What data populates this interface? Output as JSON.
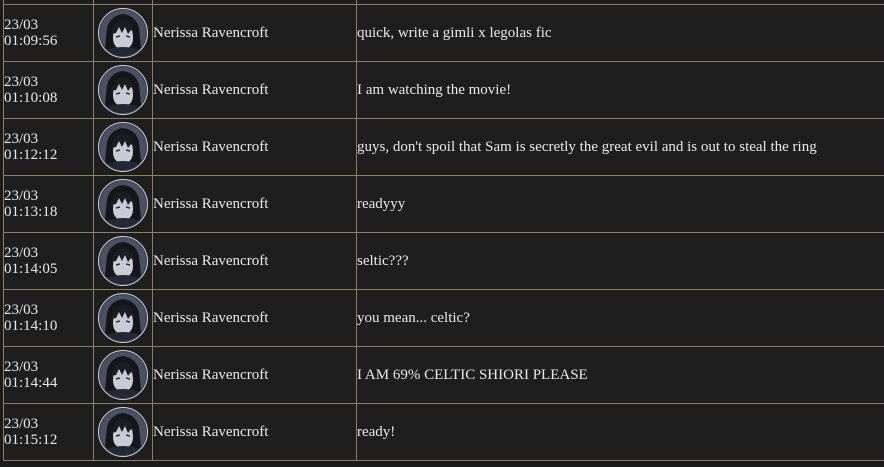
{
  "messages": [
    {
      "date": "23/03",
      "time": "01:09:56",
      "user": "Nerissa Ravencroft",
      "text": "quick, write a gimli x legolas fic"
    },
    {
      "date": "23/03",
      "time": "01:10:08",
      "user": "Nerissa Ravencroft",
      "text": "I am watching the movie!"
    },
    {
      "date": "23/03",
      "time": "01:12:12",
      "user": "Nerissa Ravencroft",
      "text": "guys, don't spoil that Sam is secretly the great evil and is out to steal the ring"
    },
    {
      "date": "23/03",
      "time": "01:13:18",
      "user": "Nerissa Ravencroft",
      "text": "readyyy"
    },
    {
      "date": "23/03",
      "time": "01:14:05",
      "user": "Nerissa Ravencroft",
      "text": "seltic???"
    },
    {
      "date": "23/03",
      "time": "01:14:10",
      "user": "Nerissa Ravencroft",
      "text": "you mean... celtic?"
    },
    {
      "date": "23/03",
      "time": "01:14:44",
      "user": "Nerissa Ravencroft",
      "text": "I AM 69% CELTIC SHIORI PLEASE"
    },
    {
      "date": "23/03",
      "time": "01:15:12",
      "user": "Nerissa Ravencroft",
      "text": "ready!"
    }
  ]
}
